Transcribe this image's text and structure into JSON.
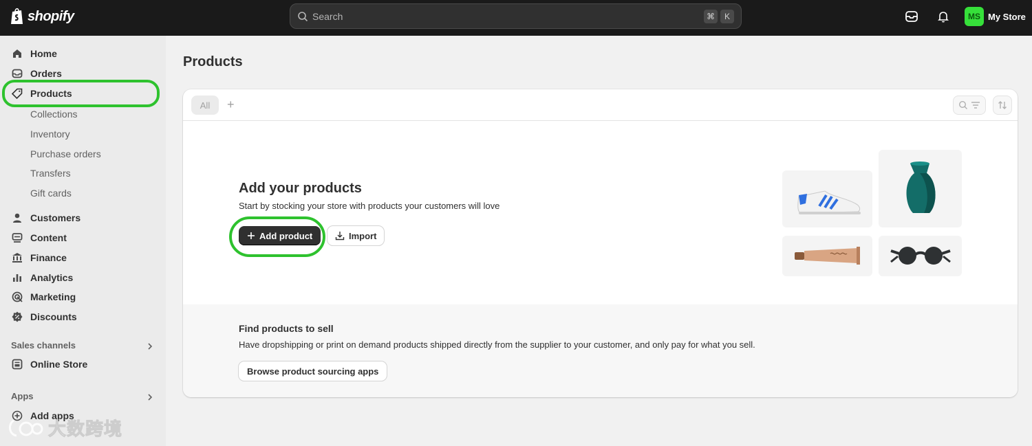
{
  "topbar": {
    "brand": "shopify",
    "search": {
      "placeholder": "Search",
      "shortcut_keys": [
        "⌘",
        "K"
      ]
    },
    "icons": [
      "inbox-icon",
      "bell-icon"
    ],
    "store": {
      "initials": "MS",
      "name": "My Store",
      "avatar_color": "#36e03a"
    }
  },
  "sidebar": {
    "items": [
      {
        "label": "Home",
        "icon": "home-icon"
      },
      {
        "label": "Orders",
        "icon": "inbox-icon"
      },
      {
        "label": "Products",
        "icon": "tag-icon",
        "active": true
      },
      {
        "label": "Customers",
        "icon": "person-icon"
      },
      {
        "label": "Content",
        "icon": "content-icon"
      },
      {
        "label": "Finance",
        "icon": "bank-icon"
      },
      {
        "label": "Analytics",
        "icon": "bar-chart-icon"
      },
      {
        "label": "Marketing",
        "icon": "target-icon"
      },
      {
        "label": "Discounts",
        "icon": "discount-icon"
      }
    ],
    "product_subitems": [
      "Collections",
      "Inventory",
      "Purchase orders",
      "Transfers",
      "Gift cards"
    ],
    "sales_channels": {
      "label": "Sales channels",
      "items": [
        {
          "label": "Online Store",
          "icon": "store-icon"
        }
      ]
    },
    "apps": {
      "label": "Apps",
      "items": [
        {
          "label": "Add apps",
          "icon": "plus-circle-icon"
        }
      ]
    }
  },
  "main": {
    "title": "Products",
    "tabs": {
      "all_label": "All",
      "add_label": "+"
    },
    "empty_state": {
      "title": "Add your products",
      "description": "Start by stocking your store with products your customers will love",
      "add_button": "Add product",
      "import_button": "Import",
      "illustrations": [
        "sneaker",
        "vase",
        "tube",
        "sunglasses"
      ]
    },
    "find_products": {
      "title": "Find products to sell",
      "description": "Have dropshipping or print on demand products shipped directly from the supplier to your customer, and only pay for what you sell.",
      "button": "Browse product sourcing apps"
    }
  },
  "watermark": {
    "text": "大数跨境"
  },
  "colors": {
    "highlight": "#2ec22e",
    "topbar": "#1a1a1a",
    "primary_button": "#303030"
  }
}
